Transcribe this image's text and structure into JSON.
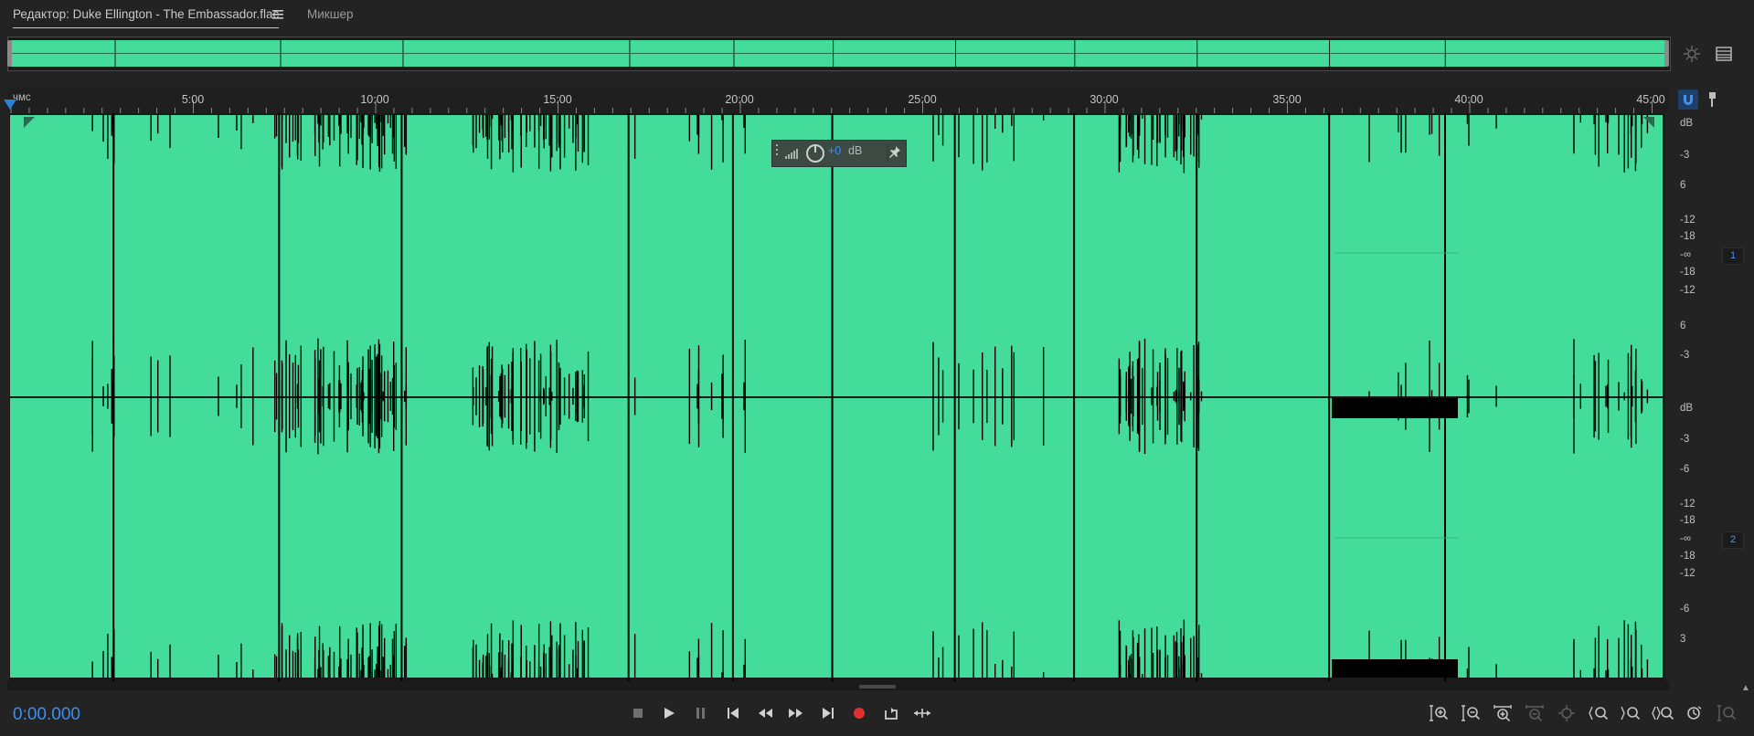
{
  "tabs": {
    "editor_label": "Редактор: Duke Ellington - The Embassador.flac",
    "editor_menu_icon": "hamburger-menu-icon",
    "mixer_label": "Микшер"
  },
  "overview": {
    "zoom_icon": "zoom-navigator-icon",
    "panel_icon": "spectral-panel-icon"
  },
  "ruler": {
    "unit_label": "чмс",
    "ticks": [
      "5:00",
      "10:00",
      "15:00",
      "20:00",
      "25:00",
      "30:00",
      "35:00",
      "40:00",
      "45:00"
    ],
    "snap_icon": "magnet-snap-icon",
    "marker_icon": "marker-pin-icon"
  },
  "hud": {
    "gain_value": "+0",
    "gain_unit": "dB",
    "pin_icon": "pin-icon"
  },
  "db_scale": {
    "channel1": [
      "dB",
      "-3",
      "6",
      "-12",
      "-18",
      "-∞",
      "-18",
      "-12",
      "6",
      "-3"
    ],
    "channel2": [
      "dB",
      "-3",
      "-6",
      "-12",
      "-18",
      "-∞",
      "-18",
      "-12",
      "-6",
      "3"
    ],
    "channel_badges": [
      "1",
      "2"
    ]
  },
  "waveform": {
    "color": "#44dc9a",
    "background": "#1a1a1a",
    "track_breaks_fraction": [
      0.063,
      0.163,
      0.237,
      0.374,
      0.437,
      0.497,
      0.571,
      0.643,
      0.717,
      0.797,
      0.867
    ]
  },
  "transport": {
    "time": "0:00.000",
    "buttons": [
      "stop",
      "play",
      "pause",
      "go-to-start",
      "rewind",
      "fast-forward",
      "go-to-end",
      "record",
      "loop",
      "skip-selection"
    ],
    "record_color": "#e03030"
  },
  "zoom_controls": [
    "zoom-in-amplitude",
    "zoom-out-amplitude",
    "zoom-in-time",
    "zoom-out-time",
    "zoom-out-full",
    "zoom-in-selection",
    "zoom-in-left",
    "zoom-in-right",
    "zoom-selection",
    "zoom-reset"
  ]
}
